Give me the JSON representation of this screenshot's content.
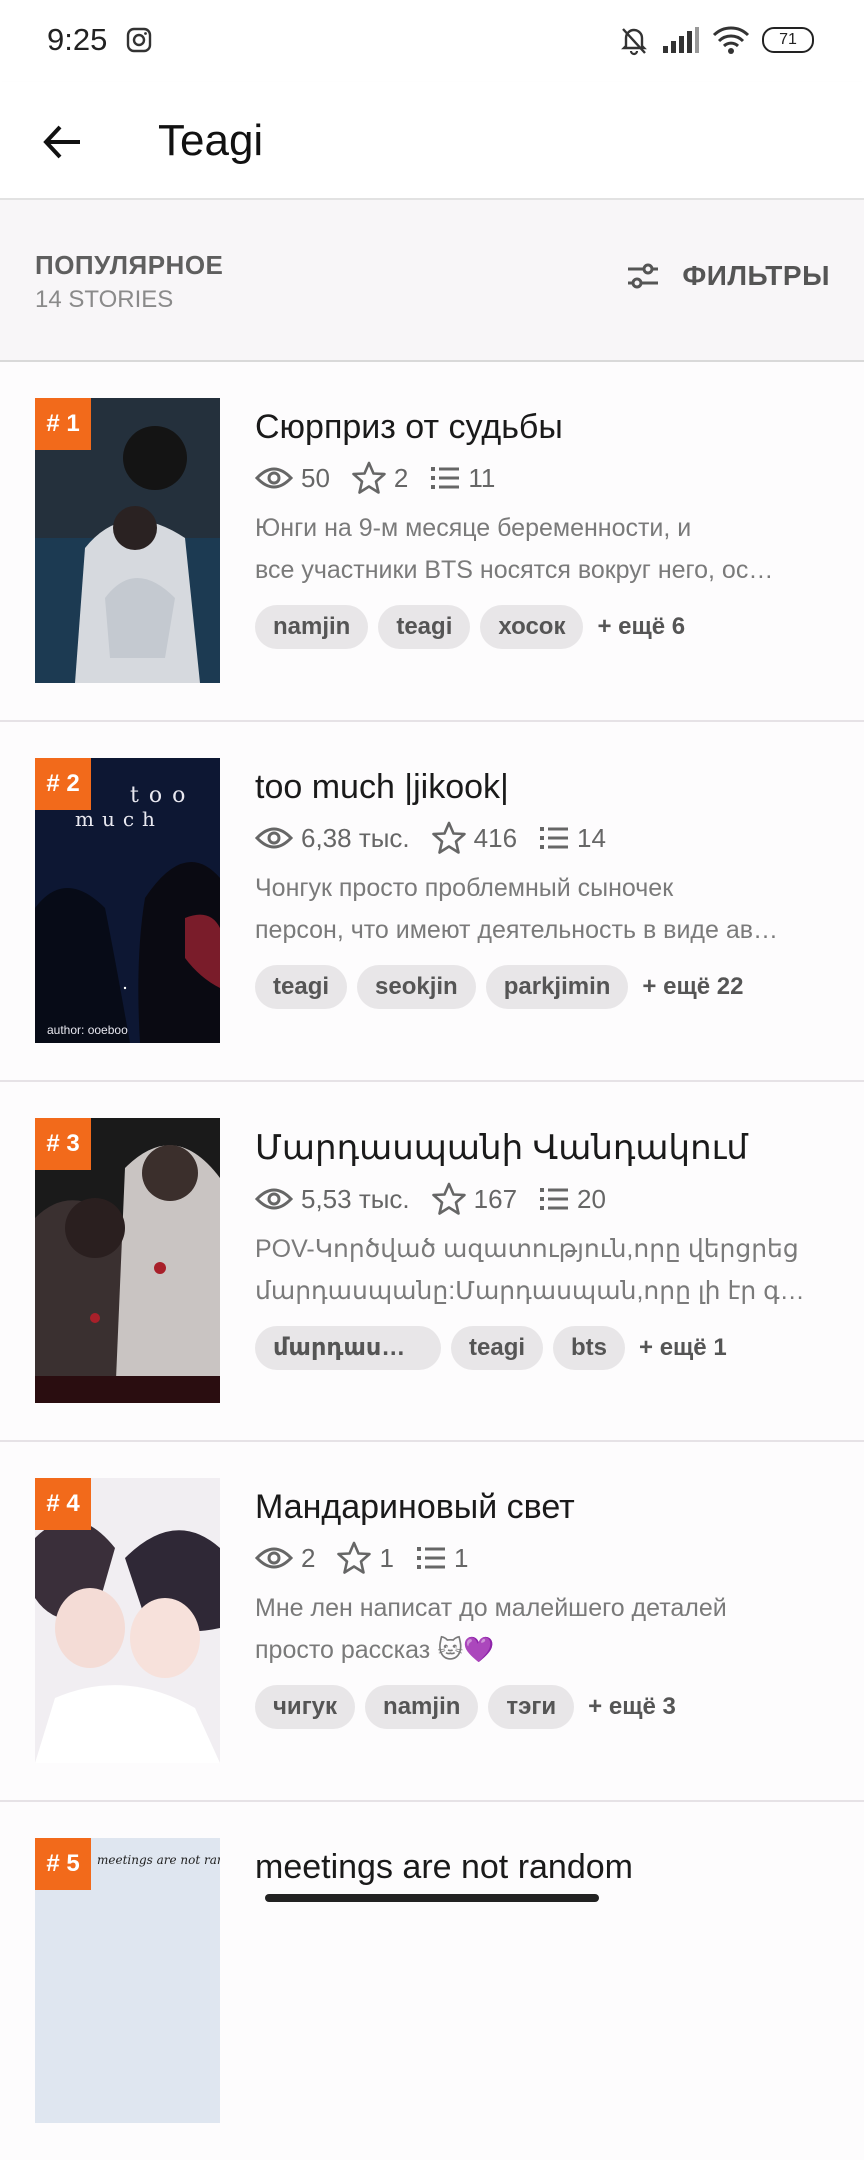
{
  "status_bar": {
    "time": "9:25",
    "battery": "71"
  },
  "app_bar": {
    "title": "Teagi"
  },
  "subheader": {
    "category": "ПОПУЛЯРНОЕ",
    "count": "14 STORIES",
    "filters_label": "ФИЛЬТРЫ"
  },
  "stories": [
    {
      "rank": "# 1",
      "title": "Сюрприз от судьбы",
      "views": "50",
      "votes": "2",
      "parts": "11",
      "desc1": "Юнги на 9-м месяце беременности, и",
      "desc2": "все участники BTS носятся вокруг него, ос…",
      "tags": [
        "namjin",
        "teagi",
        "хосок"
      ],
      "more": "+ ещё 6"
    },
    {
      "rank": "# 2",
      "title": "too much |jikook|",
      "views": "6,38 тыс.",
      "votes": "416",
      "parts": "14",
      "desc1": "Чонгук просто проблемный сыночек",
      "desc2": "персон, что имеют деятельность в виде ав…",
      "tags": [
        "teagi",
        "seokjin",
        "parkjimin"
      ],
      "more": "+ ещё 22",
      "cover_text_top": "too",
      "cover_text_mid": "much",
      "cover_author": "author: ooeboo"
    },
    {
      "rank": "# 3",
      "title": "Մարդասպանի Վանդակում",
      "views": "5,53 тыс.",
      "votes": "167",
      "parts": "20",
      "desc1": "POV-Կործված ազատություն,որը վերցրեց",
      "desc2": "մարդասպանը:Մարդասպան,որը լի էր գ…",
      "tags": [
        "մարդասպ…",
        "teagi",
        "bts"
      ],
      "more": "+ ещё 1"
    },
    {
      "rank": "# 4",
      "title": "Мандариновый свет",
      "views": "2",
      "votes": "1",
      "parts": "1",
      "desc1": "Мне лен написат до малейшего деталей",
      "desc2": "просто рассказ 🐱💜",
      "tags": [
        "чигук",
        "namjin",
        "тэги"
      ],
      "more": "+ ещё 3"
    },
    {
      "rank": "# 5",
      "title": "meetings are not random",
      "cover_text": "meetings are not random"
    }
  ]
}
